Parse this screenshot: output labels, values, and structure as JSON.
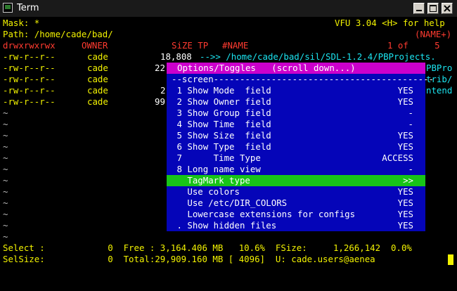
{
  "window": {
    "title": "Term"
  },
  "header": {
    "mask": "Mask: *",
    "app_help": "VFU 3.04 <H> for help",
    "path": "Path: /home/cade/bad/",
    "sort": "(NAME+)"
  },
  "columns": {
    "mode": "drwxrwxrwx",
    "owner": "OWNER",
    "size_tp": "SiZE TP",
    "name": "#NAME",
    "position": "1 of     5"
  },
  "files": [
    {
      "mode": "-rw-r--r--",
      "owner": "cade",
      "size": "18,808",
      "name": "-->> /home/cade/bad/sil/SDL-1.2.4/PBProjects."
    },
    {
      "mode": "-rw-r--r--",
      "owner": "cade",
      "size": "22",
      "name": "PBPro"
    },
    {
      "mode": "-rw-r--r--",
      "owner": "cade",
      "size": "",
      "name": "trib/"
    },
    {
      "mode": "-rw-r--r--",
      "owner": "cade",
      "size": "2",
      "name": "ntend"
    },
    {
      "mode": "-rw-r--r--",
      "owner": "cade",
      "size": "99",
      "name": ""
    }
  ],
  "tilde": "~",
  "menu": {
    "title": "Options/Toggles   (scroll down...)",
    "section": "--screen------------------------------------------",
    "items": [
      {
        "label": " 1 Show Mode  field",
        "value": "YES"
      },
      {
        "label": " 2 Show Owner field",
        "value": "YES"
      },
      {
        "label": " 3 Show Group field",
        "value": "-"
      },
      {
        "label": " 4 Show Time  field",
        "value": "-"
      },
      {
        "label": " 5 Show Size  field",
        "value": "YES"
      },
      {
        "label": " 6 Show Type  field",
        "value": "YES"
      },
      {
        "label": " 7      Time Type",
        "value": "ACCESS"
      },
      {
        "label": " 8 Long name view",
        "value": "-"
      },
      {
        "label": "   TagMark type",
        "value": ">>"
      },
      {
        "label": "   Use colors",
        "value": "YES"
      },
      {
        "label": "   Use /etc/DIR_COLORS",
        "value": "YES"
      },
      {
        "label": "   Lowercase extensions for configs",
        "value": "YES"
      },
      {
        "label": " . Show hidden files",
        "value": "YES"
      }
    ],
    "selected_index": 8
  },
  "status": {
    "select": "Select :            0  Free : 3,164.406 MB   10.6%  FSize:     1,266,142  0.0%",
    "selsize": "SelSize:            0  Total:29,909.160 MB [ 4096]  U: cade.users@aenea"
  },
  "colors": {
    "terminal_bg": "#000000",
    "menu_bg": "#0505b8",
    "menu_title_bg": "#cc00cc",
    "menu_selected_bg": "#18c418",
    "header_text": "#f2f200",
    "columns_text": "#ff3b30"
  }
}
